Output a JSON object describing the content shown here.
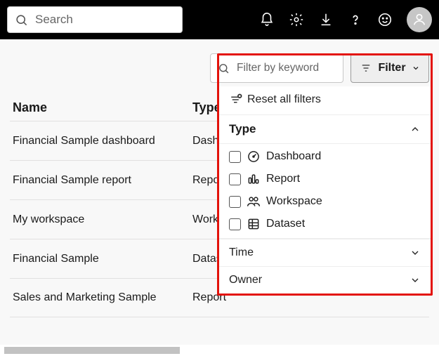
{
  "header": {
    "search_placeholder": "Search"
  },
  "toolbar": {
    "filter_keyword_placeholder": "Filter by keyword",
    "filter_button_label": "Filter"
  },
  "table": {
    "columns": {
      "name": "Name",
      "type": "Type"
    },
    "rows": [
      {
        "name": "Financial Sample dashboard",
        "type": "Dashboard"
      },
      {
        "name": "Financial Sample report",
        "type": "Report"
      },
      {
        "name": "My workspace",
        "type": "Workspace"
      },
      {
        "name": "Financial Sample",
        "type": "Dataset"
      },
      {
        "name": "Sales and Marketing Sample",
        "type": "Report"
      }
    ]
  },
  "panel": {
    "reset_label": "Reset all filters",
    "sections": {
      "type": {
        "label": "Type",
        "options": [
          {
            "label": "Dashboard",
            "icon": "gauge-icon"
          },
          {
            "label": "Report",
            "icon": "bar-chart-icon"
          },
          {
            "label": "Workspace",
            "icon": "people-icon"
          },
          {
            "label": "Dataset",
            "icon": "grid-icon"
          }
        ]
      },
      "time": {
        "label": "Time"
      },
      "owner": {
        "label": "Owner"
      }
    }
  }
}
